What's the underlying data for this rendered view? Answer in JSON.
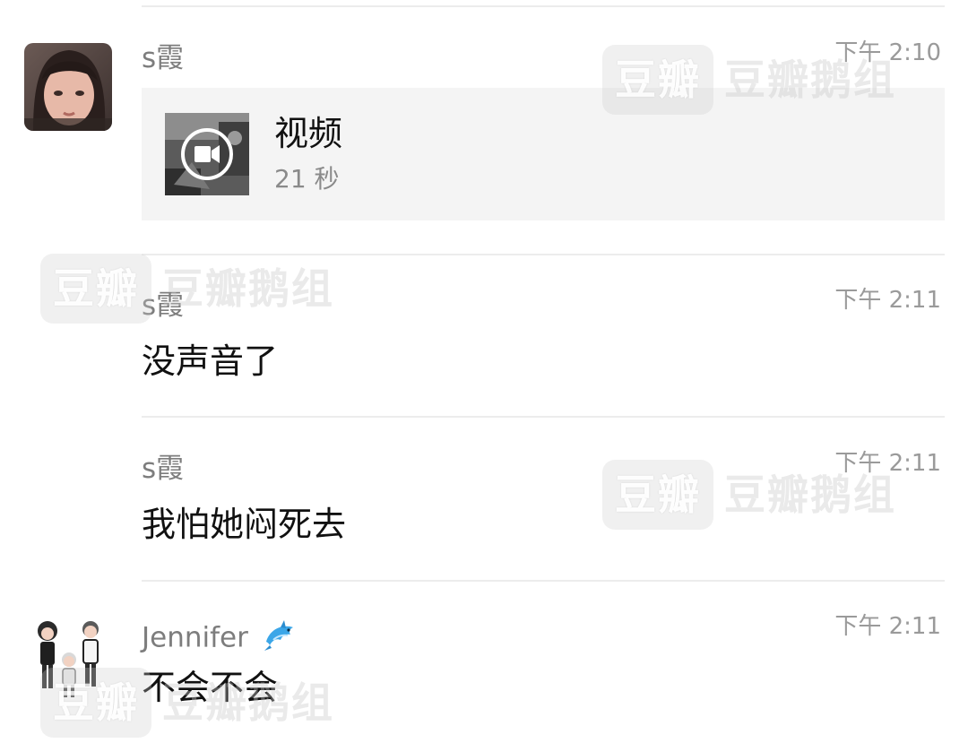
{
  "messages": [
    {
      "sender": "s霞",
      "time": "下午 2:10",
      "video": {
        "label": "视频",
        "duration": "21 秒"
      }
    },
    {
      "sender": "s霞",
      "time": "下午 2:11",
      "text": "没声音了"
    },
    {
      "sender": "s霞",
      "time": "下午 2:11",
      "text": "我怕她闷死去"
    },
    {
      "sender": "Jennifer",
      "sender_emoji": "🐬",
      "time": "下午 2:11",
      "text": "不会不会"
    }
  ],
  "watermark": {
    "badge": "豆瓣",
    "text": "豆瓣鹅组"
  },
  "icons": {
    "video_play": "video-camera-icon",
    "sender_emoji": "dolphin-icon"
  }
}
